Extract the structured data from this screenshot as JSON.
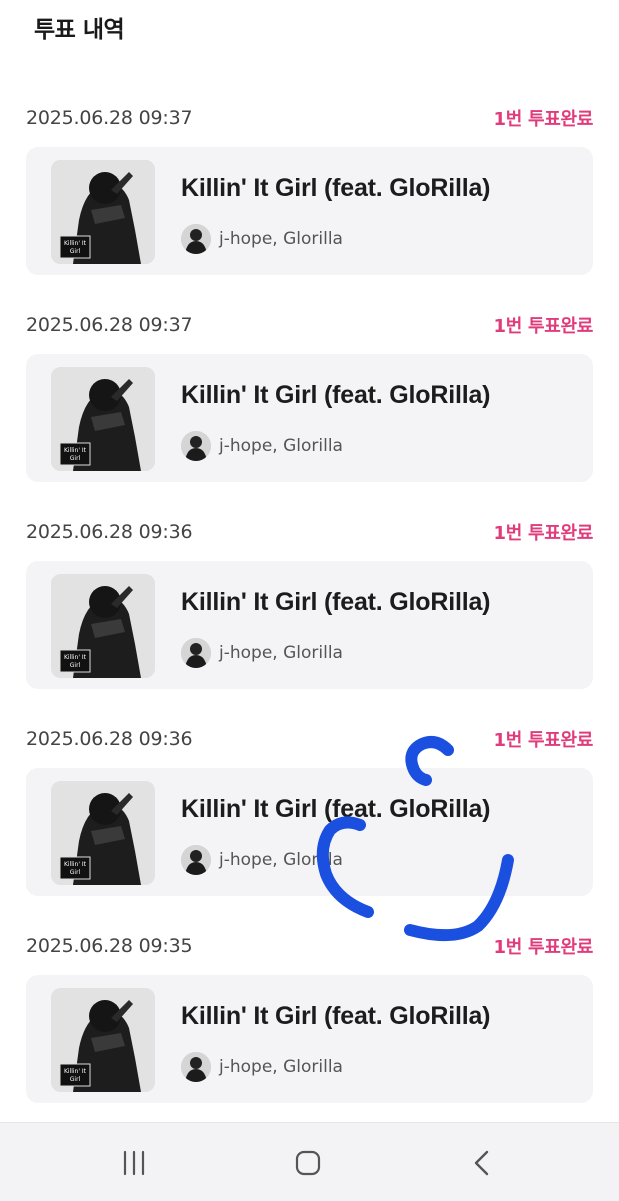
{
  "header": {
    "title": "투표 내역"
  },
  "entries": [
    {
      "date": "2025.06.28 09:37",
      "status": "1번 투표완료",
      "song": "Killin' It Girl (feat. GloRilla)",
      "artist": "j-hope, Glorilla"
    },
    {
      "date": "2025.06.28 09:37",
      "status": "1번 투표완료",
      "song": "Killin' It Girl (feat. GloRilla)",
      "artist": "j-hope, Glorilla"
    },
    {
      "date": "2025.06.28 09:36",
      "status": "1번 투표완료",
      "song": "Killin' It Girl (feat. GloRilla)",
      "artist": "j-hope, Glorilla"
    },
    {
      "date": "2025.06.28 09:36",
      "status": "1번 투표완료",
      "song": "Killin' It Girl (feat. GloRilla)",
      "artist": "j-hope, Glorilla"
    },
    {
      "date": "2025.06.28 09:35",
      "status": "1번 투표완료",
      "song": "Killin' It Girl (feat. GloRilla)",
      "artist": "j-hope, Glorilla"
    }
  ],
  "album_art_text": "Killin' It Girl",
  "navbar": {
    "buttons": [
      "recent-apps-icon",
      "home-icon",
      "back-icon"
    ]
  },
  "colors": {
    "status": "#e03c7c",
    "card": "#f4f4f6",
    "scribble": "#1a4fe0"
  }
}
